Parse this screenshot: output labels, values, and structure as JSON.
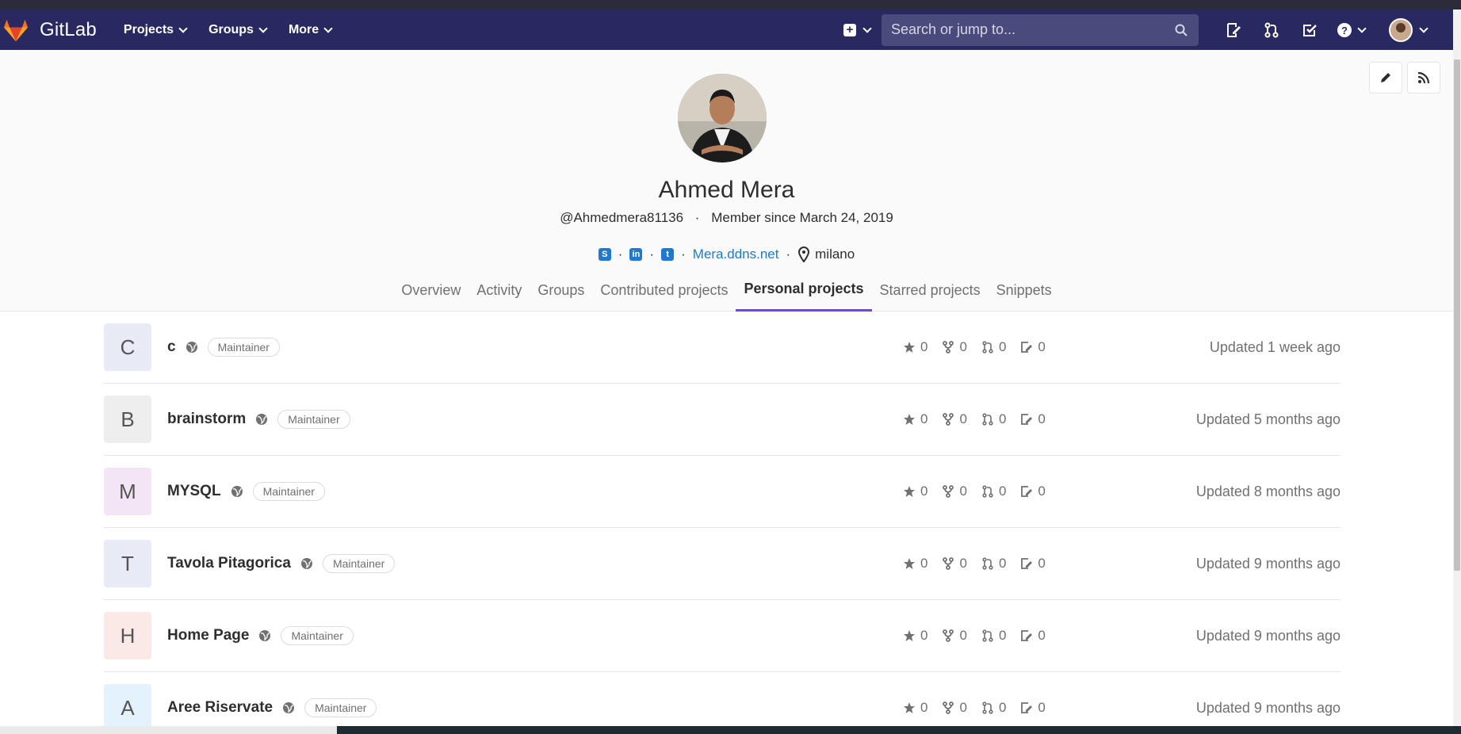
{
  "nav": {
    "logo_text": "GitLab",
    "menu": [
      {
        "label": "Projects"
      },
      {
        "label": "Groups"
      },
      {
        "label": "More"
      }
    ],
    "search_placeholder": "Search or jump to..."
  },
  "profile": {
    "name": "Ahmed Mera",
    "username": "@Ahmedmera81136",
    "member_since": "Member since March 24, 2019",
    "website": "Mera.ddns.net",
    "location": "milano",
    "tabs": [
      {
        "label": "Overview"
      },
      {
        "label": "Activity"
      },
      {
        "label": "Groups"
      },
      {
        "label": "Contributed projects"
      },
      {
        "label": "Personal projects"
      },
      {
        "label": "Starred projects"
      },
      {
        "label": "Snippets"
      }
    ],
    "active_tab": "Personal projects"
  },
  "projects": [
    {
      "initial": "C",
      "name": "c",
      "role": "Maintainer",
      "stars": "0",
      "forks": "0",
      "merge_requests": "0",
      "issues": "0",
      "updated": "Updated 1 week ago",
      "color": "#e8eaf6"
    },
    {
      "initial": "B",
      "name": "brainstorm",
      "role": "Maintainer",
      "stars": "0",
      "forks": "0",
      "merge_requests": "0",
      "issues": "0",
      "updated": "Updated 5 months ago",
      "color": "#eeeeee"
    },
    {
      "initial": "M",
      "name": "MYSQL",
      "role": "Maintainer",
      "stars": "0",
      "forks": "0",
      "merge_requests": "0",
      "issues": "0",
      "updated": "Updated 8 months ago",
      "color": "#f3e5f5"
    },
    {
      "initial": "T",
      "name": "Tavola Pitagorica",
      "role": "Maintainer",
      "stars": "0",
      "forks": "0",
      "merge_requests": "0",
      "issues": "0",
      "updated": "Updated 9 months ago",
      "color": "#e8eaf6"
    },
    {
      "initial": "H",
      "name": "Home Page",
      "role": "Maintainer",
      "stars": "0",
      "forks": "0",
      "merge_requests": "0",
      "issues": "0",
      "updated": "Updated 9 months ago",
      "color": "#fbe9e7"
    },
    {
      "initial": "A",
      "name": "Aree Riservate",
      "role": "Maintainer",
      "stars": "0",
      "forks": "0",
      "merge_requests": "0",
      "issues": "0",
      "updated": "Updated 9 months ago",
      "color": "#e3f2fd"
    }
  ],
  "colors": {
    "navbar": "#292961",
    "accent": "#6b4fbb",
    "link": "#1f78d1"
  },
  "icons": {
    "social": [
      "skype-icon",
      "linkedin-icon",
      "twitter-icon"
    ]
  }
}
